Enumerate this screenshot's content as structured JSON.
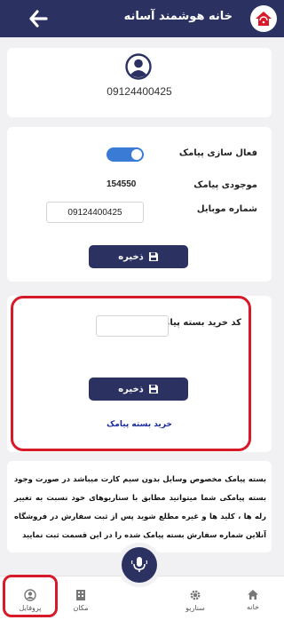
{
  "header": {
    "title": "خانه هوشمند آسانه"
  },
  "profile": {
    "phone": "09124400425"
  },
  "sms_settings": {
    "toggle_label": "فعال سازی پیامک",
    "toggle_on": true,
    "balance_label": "موجودی پیامک",
    "balance_value": "154550",
    "mobile_label": "شماره موبایل",
    "mobile_value": "09124400425",
    "save_label": "ذخیره"
  },
  "package": {
    "code_label": "کد خرید بسته پیامک",
    "code_value": "",
    "save_label": "ذخیره",
    "buy_link": "خرید بسته پیامک"
  },
  "info": {
    "text": "بسته پیامک مخصوص وسایل بدون سیم کارت میباشد در صورت وجود بسته پیامکی شما میتوانید مطابق با سناریوهای خود نسبت به تغییر رله ها ، کلید ها و غیره مطلع شوید پس از ثبت سفارش در فروشگاه آنلاین شماره سفارش بسته پیامک شده را در این قسمت ثبت نمایید"
  },
  "nav": {
    "home": "خانه",
    "scenario": "سناریو",
    "place": "مکان",
    "profile": "پروفایل"
  },
  "colors": {
    "primary": "#2b3160",
    "highlight": "#d7192a",
    "toggle": "#3a7bd5",
    "link": "#1a2a9e"
  }
}
